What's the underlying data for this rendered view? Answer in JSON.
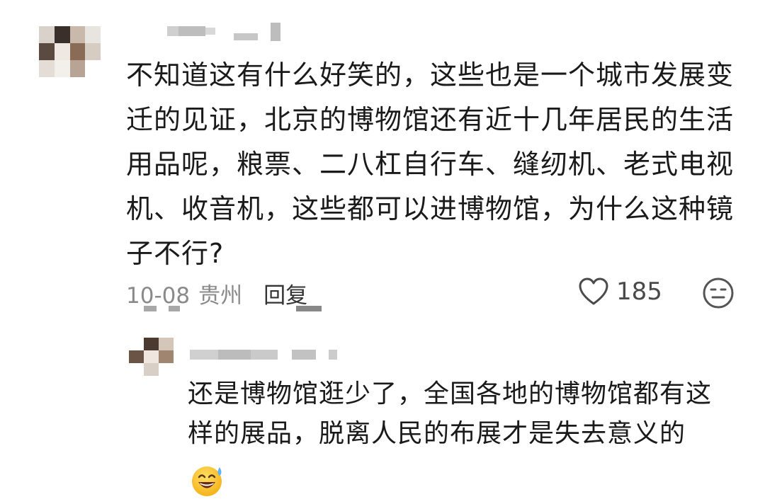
{
  "comment": {
    "text_lines": [
      "不知道这有什么好笑的，这些也是一个城市发展变",
      "迁的见证，北京的博物馆还有近十几年居民的生活",
      "用品呢，粮票、二八杠自行车、缝纫机、老式电视",
      "机、收音机，这些都可以进博物馆，为什么这种镜",
      "子不行?"
    ],
    "date": "10-08",
    "location": "贵州",
    "reply_label": "回复",
    "like_count": "185",
    "like_icon": "heart-outline-icon",
    "emoji_icon": "emoji-face-icon"
  },
  "reply": {
    "text_lines": [
      "还是博物馆逛少了，全国各地的博物馆都有这",
      "样的展品，脱离人民的布展才是失去意义的"
    ],
    "emoji": "sweat-smile-emoji"
  },
  "colors": {
    "text": "#1a1a1a",
    "meta": "#8a8a8a",
    "background": "#ffffff"
  }
}
